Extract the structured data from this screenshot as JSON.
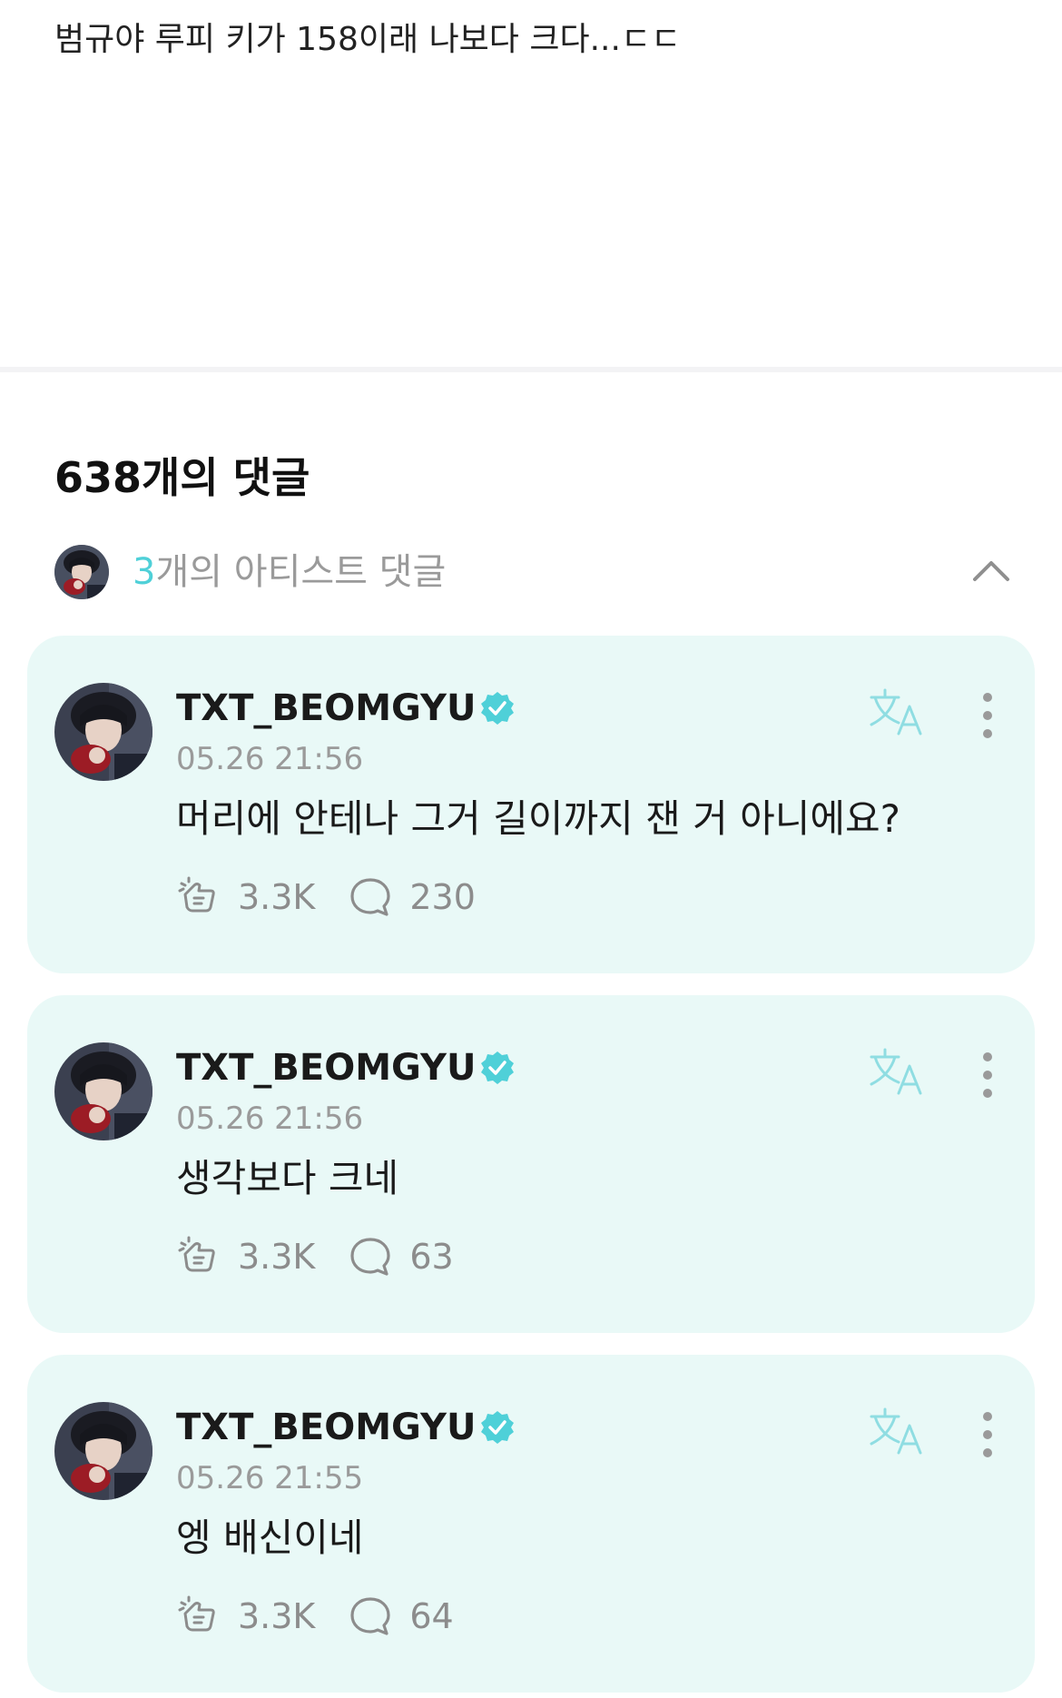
{
  "post": {
    "text": "범규야 루피 키가 158이래 나보다 크다...ㄷㄷ"
  },
  "comments_header": "638개의 댓글",
  "artist_toggle": {
    "count": "3",
    "text": "개의 아티스트 댓글",
    "avatar_icon": "artist-avatar-icon",
    "chevron_icon": "chevron-up-icon"
  },
  "colors": {
    "accent": "#4fd0d8",
    "card_background": "#e9f9f7",
    "muted_text": "#9a9a9a"
  },
  "comments": [
    {
      "username": "TXT_BEOMGYU",
      "timestamp": "05.26 21:56",
      "text": "머리에 안테나 그거 길이까지 잰 거 아니에요?",
      "likes": "3.3K",
      "replies": "230"
    },
    {
      "username": "TXT_BEOMGYU",
      "timestamp": "05.26 21:56",
      "text": "생각보다 크네",
      "likes": "3.3K",
      "replies": "63"
    },
    {
      "username": "TXT_BEOMGYU",
      "timestamp": "05.26 21:55",
      "text": "엥 배신이네",
      "likes": "3.3K",
      "replies": "64"
    }
  ],
  "icons": {
    "verified": "verified-badge-icon",
    "translate": "translate-icon",
    "more": "more-vertical-icon",
    "like": "cheer-icon",
    "reply": "speech-bubble-icon"
  }
}
